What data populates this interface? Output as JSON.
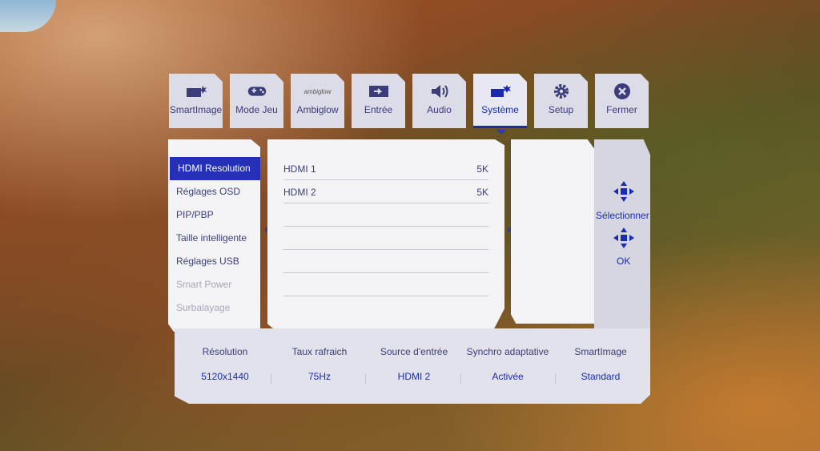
{
  "tabs": [
    {
      "label": "SmartImage",
      "icon": "smartimage-icon"
    },
    {
      "label": "Mode Jeu",
      "icon": "gamepad-icon"
    },
    {
      "label": "Ambiglow",
      "icon": "ambiglow-logo"
    },
    {
      "label": "Entrée",
      "icon": "input-icon"
    },
    {
      "label": "Audio",
      "icon": "speaker-icon"
    },
    {
      "label": "Système",
      "icon": "system-icon",
      "active": true
    },
    {
      "label": "Setup",
      "icon": "gear-icon"
    },
    {
      "label": "Fermer",
      "icon": "close-icon"
    }
  ],
  "ambiglow_logo_text": "ambiglow",
  "menu": [
    {
      "label": "HDMI Resolution",
      "state": "selected"
    },
    {
      "label": "Réglages OSD",
      "state": "normal"
    },
    {
      "label": "PIP/PBP",
      "state": "normal"
    },
    {
      "label": "Taille intelligente",
      "state": "normal"
    },
    {
      "label": "Réglages USB",
      "state": "normal"
    },
    {
      "label": "Smart Power",
      "state": "disabled"
    },
    {
      "label": "Surbalayage",
      "state": "disabled"
    }
  ],
  "submenu": [
    {
      "name": "HDMI 1",
      "value": "5K"
    },
    {
      "name": "HDMI 2",
      "value": "5K"
    }
  ],
  "nav": {
    "select_label": "Sélectionner",
    "ok_label": "OK"
  },
  "info": [
    {
      "label": "Résolution",
      "value": "5120x1440"
    },
    {
      "label": "Taux rafraich",
      "value": "75Hz"
    },
    {
      "label": "Source d'entrée",
      "value": "HDMI 2"
    },
    {
      "label": "Synchro adaptative",
      "value": "Activée"
    },
    {
      "label": "SmartImage",
      "value": "Standard"
    }
  ],
  "colors": {
    "accent": "#2430b8",
    "text": "#3a3d7a",
    "panel": "#f4f4f7"
  }
}
